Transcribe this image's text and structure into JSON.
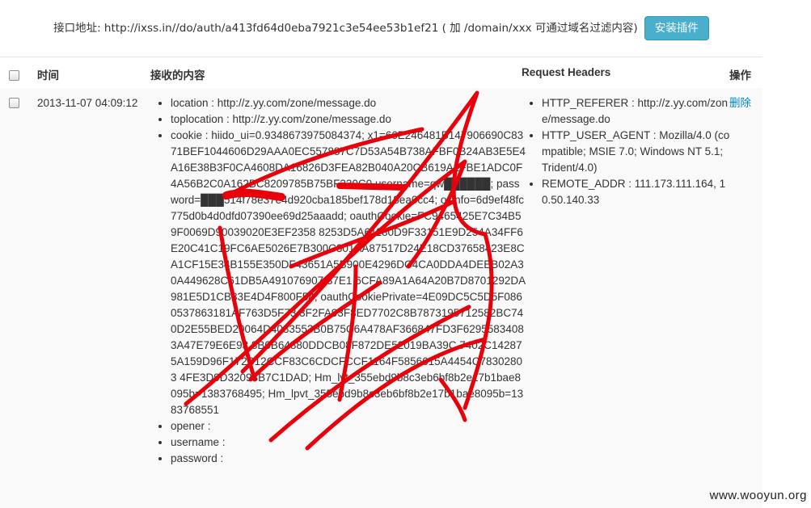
{
  "top": {
    "api_text": "接口地址: http://ixss.in//do/auth/a413fd64d0eba7921c3e54ee53b1ef21 ( 加 /domain/xxx 可通过域名过滤内容)",
    "install_button": "安装插件"
  },
  "table": {
    "headers": {
      "time": "时间",
      "content": "接收的内容",
      "request_headers": "Request Headers",
      "action": "操作"
    },
    "row": {
      "time": "2013-11-07 04:09:12",
      "content_items": [
        "location : http://z.yy.com/zone/message.do",
        "toplocation : http://z.yy.com/zone/message.do",
        "cookie : hiido_ui=0.9348673975084374; x1=66E246481B147906690C8371BEF1044606D29AAA0EC557887C7D53A54B738AFBF0B24AB3E5E4A16E38B3F0CA4608DA16826D3FEA82B040A20CB619A2FBE1ADC0F4A56B2C0A162BC8209785B75BF230C0 username=qw██████; password=███514f78e37e4d920cba185bef178d18ea0cc4; osinfo=6d9ef48fc775d0b4d0dfd07390ee69d25aaadd; oauthCookie=FC9465425E7C34B59F0069D90039020E3EF2358 8253D5A61180D9F33151E9D254A34FF6E20C41C19FC6AE5026E7B300C301AA87517D24E18CD37658423E8CA1CF15E34B155E350DF43651A5B900E4296DC4CA0DDA4DEEB02A30A449628C61DB5A491076907 37E1 6CFA89A1A64A20B7D8701292DA981E5D1CB83E4D4F800F54; oauthCookiePrivate=4E09DC5C5D5F0860537863181AF763D5F73 3F2FA93F8ED7702C8B7873195712582BC740D2E55BED20064D4083553B0B75C6A478AF366847FD3F62955834083A47E79E6E93 8B0B64880DDCB08F872DE52019BA39C 7402C142875A159D96F172B12CCF83C6CDCFCCF1164F5856615A4454C78302803 4FE3D9D32093B7C1DAD; Hm_lvt_355ebd9b8c3eb6bf8b2e17b1bae8095b=1383768495; Hm_lpvt_355ebd9b8c3eb6bf8b2e17b1bae8095b=1383768551",
        "opener :",
        "username :",
        "password :"
      ],
      "header_items": [
        "HTTP_REFERER : http://z.yy.com/zone/message.do",
        "HTTP_USER_AGENT : Mozilla/4.0 (compatible; MSIE 7.0; Windows NT 5.1; Trident/4.0)",
        "REMOTE_ADDR : 111.173.111.164, 10.50.140.33"
      ],
      "delete_label": "删除"
    }
  },
  "watermark": "www.wooyun.org",
  "colors": {
    "scribble": "#e8000b",
    "accent_button": "#49afcd",
    "link": "#0088cc"
  }
}
